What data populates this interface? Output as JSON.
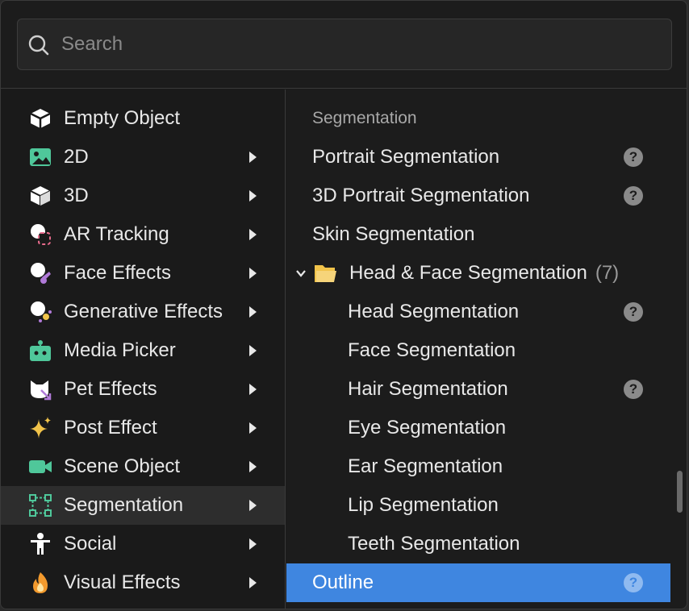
{
  "search": {
    "placeholder": "Search",
    "value": ""
  },
  "categories": [
    {
      "label": "Empty Object",
      "icon": "cube-outline-icon",
      "has_submenu": false
    },
    {
      "label": "2D",
      "icon": "image-icon",
      "has_submenu": true
    },
    {
      "label": "3D",
      "icon": "cube-icon",
      "has_submenu": true
    },
    {
      "label": "AR Tracking",
      "icon": "ar-tracking-icon",
      "has_submenu": true
    },
    {
      "label": "Face Effects",
      "icon": "face-effects-icon",
      "has_submenu": true
    },
    {
      "label": "Generative Effects",
      "icon": "generative-effects-icon",
      "has_submenu": true
    },
    {
      "label": "Media Picker",
      "icon": "media-picker-icon",
      "has_submenu": true
    },
    {
      "label": "Pet Effects",
      "icon": "pet-effects-icon",
      "has_submenu": true
    },
    {
      "label": "Post Effect",
      "icon": "sparkle-icon",
      "has_submenu": true
    },
    {
      "label": "Scene Object",
      "icon": "camera-icon",
      "has_submenu": true
    },
    {
      "label": "Segmentation",
      "icon": "segmentation-icon",
      "has_submenu": true,
      "active": true
    },
    {
      "label": "Social",
      "icon": "person-icon",
      "has_submenu": true
    },
    {
      "label": "Visual Effects",
      "icon": "flame-icon",
      "has_submenu": true
    }
  ],
  "submenu": {
    "title": "Segmentation",
    "items": [
      {
        "label": "Portrait Segmentation",
        "help": true
      },
      {
        "label": "3D Portrait Segmentation",
        "help": true
      },
      {
        "label": "Skin Segmentation",
        "help": false
      }
    ],
    "folder": {
      "label": "Head & Face Segmentation",
      "count": "(7)",
      "expanded": true
    },
    "folder_items": [
      {
        "label": "Head Segmentation",
        "help": true
      },
      {
        "label": "Face Segmentation",
        "help": false
      },
      {
        "label": "Hair Segmentation",
        "help": true
      },
      {
        "label": "Eye Segmentation",
        "help": false
      },
      {
        "label": "Ear Segmentation",
        "help": false
      },
      {
        "label": "Lip Segmentation",
        "help": false
      },
      {
        "label": "Teeth Segmentation",
        "help": false
      }
    ],
    "selected": {
      "label": "Outline",
      "help": true
    },
    "help_glyph": "?"
  },
  "colors": {
    "accent": "#3f86e0",
    "green": "#4fc79a",
    "purple": "#b07ad8",
    "yellow": "#f1c34a",
    "orange": "#f39a2d"
  }
}
